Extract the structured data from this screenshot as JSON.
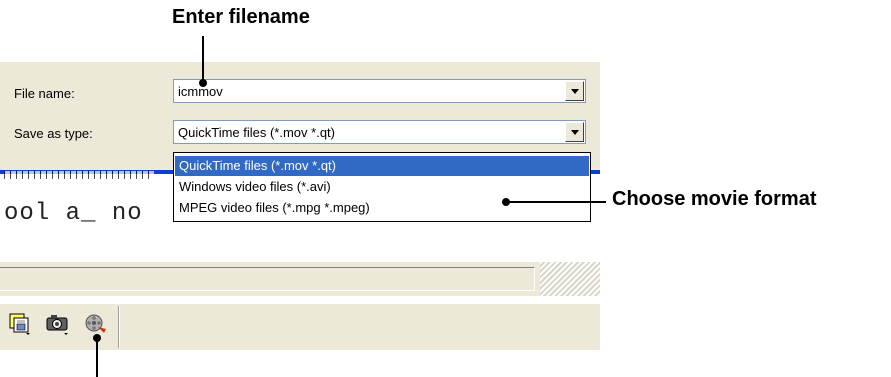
{
  "callouts": {
    "enter_filename": "Enter filename",
    "choose_format": "Choose movie format"
  },
  "dialog": {
    "file_name_label": "File name:",
    "file_name_value": "icmmov",
    "save_as_label": "Save as type:",
    "save_as_value": "QuickTime files (*.mov *.qt)",
    "options": [
      "QuickTime files (*.mov *.qt)",
      "Windows video files (*.avi)",
      "MPEG video files (*.mpg *.mpeg)"
    ],
    "selected_index": 0
  },
  "background": {
    "code_text": "ool a_ no"
  },
  "toolbar": {
    "icons": [
      "save-image-icon",
      "camera-icon",
      "movie-reel-icon"
    ]
  },
  "colors": {
    "dialog_bg": "#ece9d8",
    "selection": "#316ac5",
    "accent_bar": "#0a3fd1"
  }
}
